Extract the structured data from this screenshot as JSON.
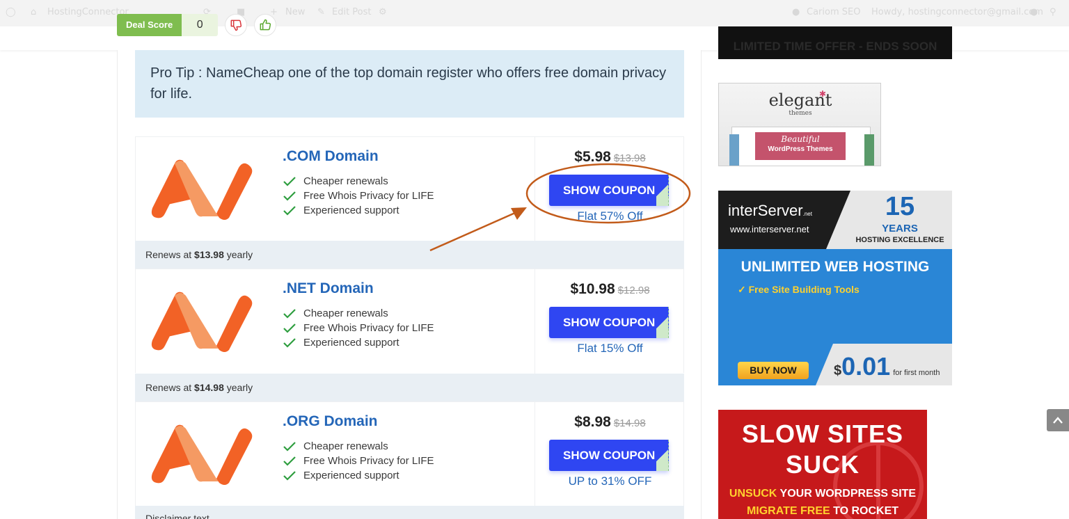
{
  "admin_bar": {
    "site_name": "HostingConnector",
    "new_label": "New",
    "edit_post_label": "Edit Post",
    "seo_label": "Cariom SEO",
    "howdy": "Howdy, hostingconnector@gmail.com"
  },
  "deal_score": {
    "label": "Deal Score",
    "value": "0"
  },
  "pro_tip": "Pro Tip : NameCheap one of the top domain register who offers free domain privacy for life.",
  "offers": [
    {
      "title": ".COM Domain",
      "features": [
        "Cheaper renewals",
        "Free Whois Privacy for LIFE",
        "Experienced support"
      ],
      "price": "$5.98",
      "old_price": "$13.98",
      "button": "SHOW COUPON",
      "discount": "Flat 57% Off",
      "renew_prefix": "Renews at",
      "renew_amount": "$13.98",
      "renew_suffix": "yearly"
    },
    {
      "title": ".NET Domain",
      "features": [
        "Cheaper renewals",
        "Free Whois Privacy for LIFE",
        "Experienced support"
      ],
      "price": "$10.98",
      "old_price": "$12.98",
      "button": "SHOW COUPON",
      "discount": "Flat 15% Off",
      "renew_prefix": "Renews at",
      "renew_amount": "$14.98",
      "renew_suffix": "yearly"
    },
    {
      "title": ".ORG Domain",
      "features": [
        "Cheaper renewals",
        "Free Whois Privacy for LIFE",
        "Experienced support"
      ],
      "price": "$8.98",
      "old_price": "$14.98",
      "button": "SHOW COUPON",
      "discount": "UP to 31% OFF"
    }
  ],
  "disclaimer": "Disclaimer text",
  "ads": {
    "limited": "LIMITED TIME OFFER - ENDS SOON",
    "elegant": {
      "brand": "elegant",
      "sub": "themes",
      "banner_line1": "Beautiful",
      "banner_line2": "WordPress Themes"
    },
    "interserver": {
      "brand": "interServer",
      "brand_suffix": ".net",
      "url": "www.interserver.net",
      "years_number": "15",
      "years_label": "YEARS",
      "excellence": "HOSTING EXCELLENCE",
      "headline": "UNLIMITED WEB HOSTING",
      "feature": "Free Site Building Tools",
      "buy_button": "BUY NOW",
      "currency": "$",
      "price": "0.01",
      "price_note": "for first month"
    },
    "slow": {
      "line1": "SLOW SITES",
      "line2": "SUCK",
      "line3_highlight": "UNSUCK",
      "line3_rest": "YOUR WORDPRESS SITE",
      "line4_highlight": "MIGRATE FREE",
      "line4_rest": "TO ROCKET"
    }
  },
  "colors": {
    "accent_blue": "#2466b8",
    "coupon_button": "#2f46f2",
    "deal_green": "#7fbd4f",
    "annotation": "#c25b1a"
  }
}
